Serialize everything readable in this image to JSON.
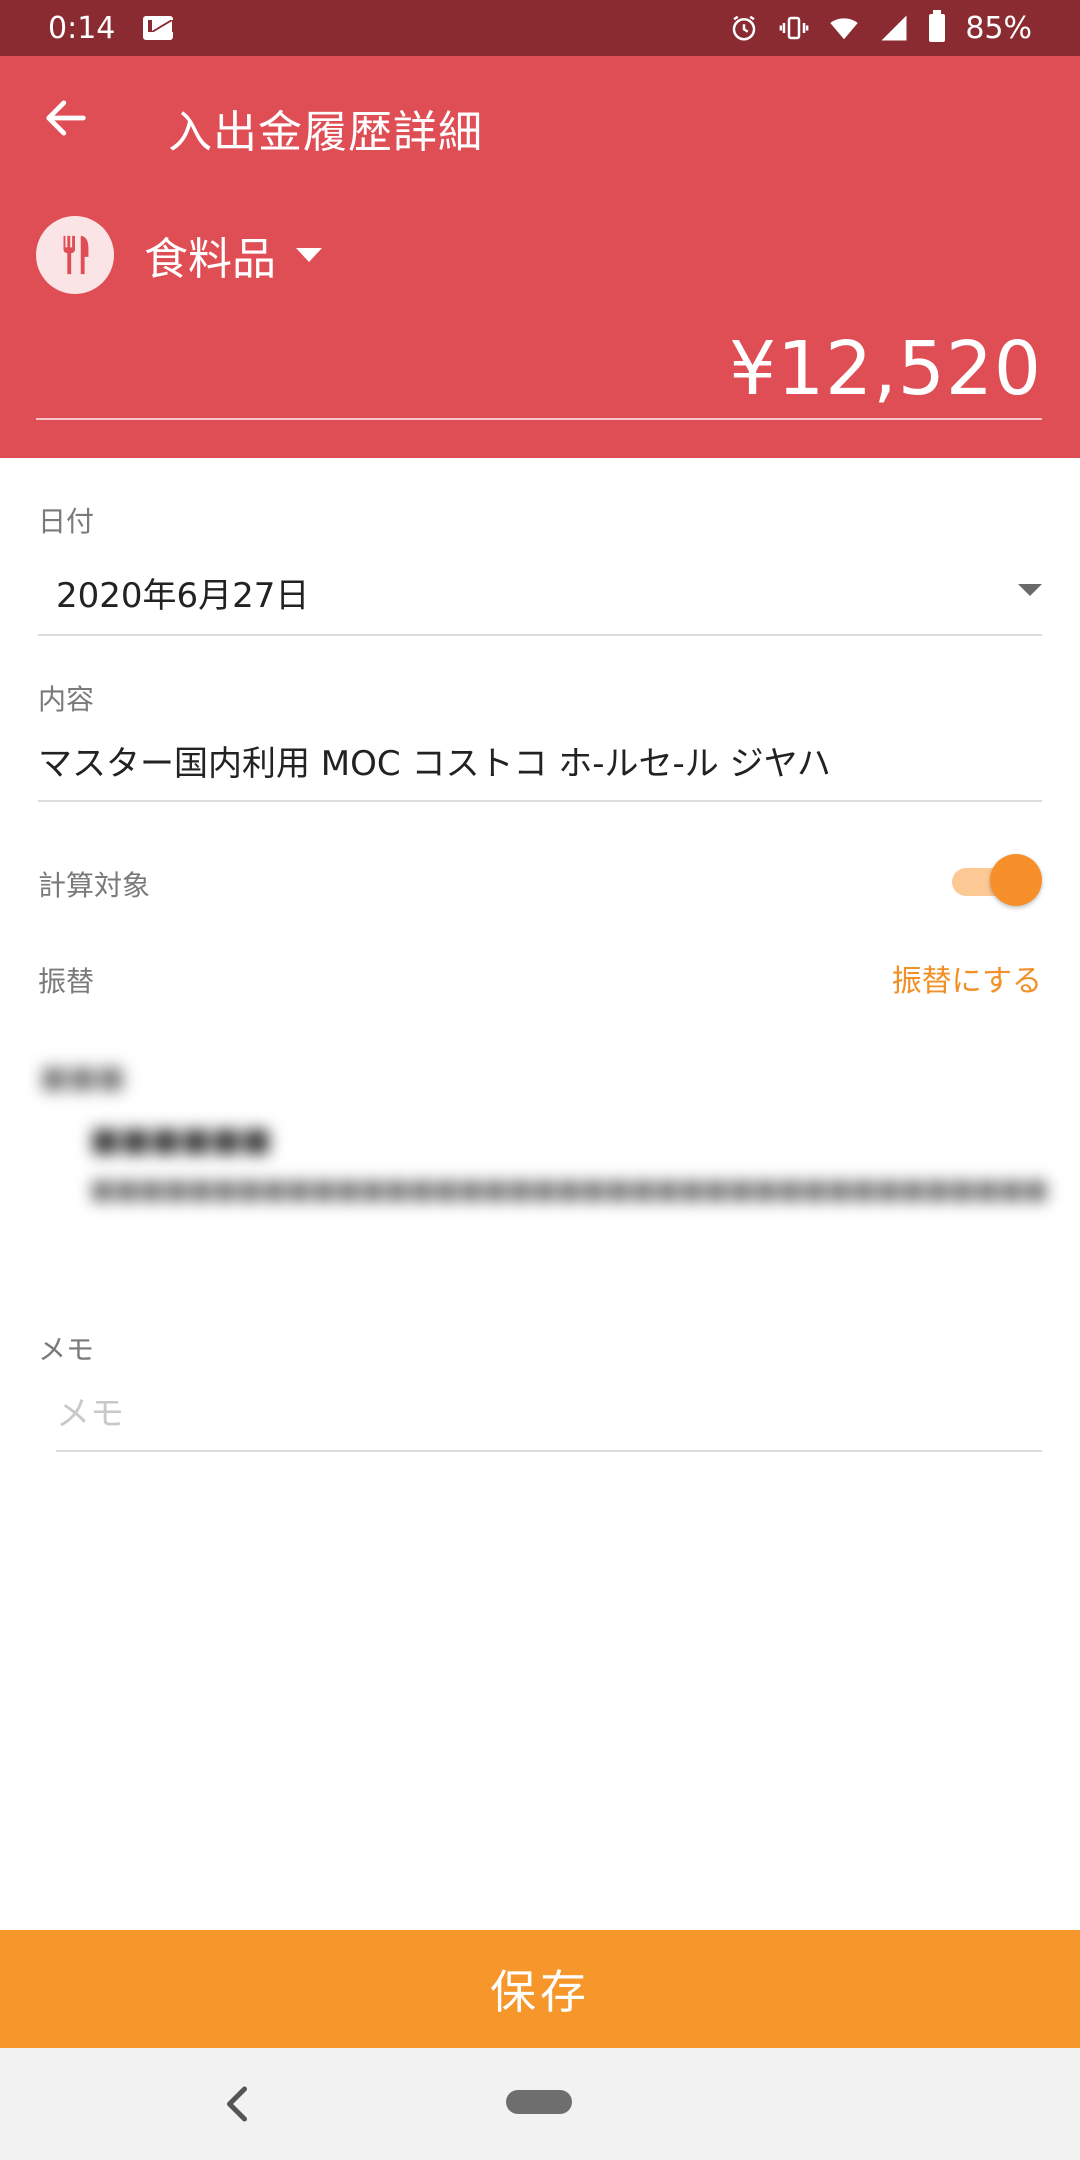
{
  "status_bar": {
    "time": "0:14",
    "battery": "85%",
    "icons": [
      "mail-icon",
      "alarm-icon",
      "vibrate-icon",
      "wifi-icon",
      "signal-icon",
      "battery-icon"
    ]
  },
  "header": {
    "title": "入出金履歴詳細",
    "category": {
      "label": "食料品",
      "icon": "fork-knife-icon"
    },
    "amount": "¥12,520",
    "color": "#e04e55"
  },
  "form": {
    "date": {
      "label": "日付",
      "value": "2020年6月27日"
    },
    "content": {
      "label": "内容",
      "value": "マスター国内利用 MOC コストコ ホ-ルセ-ル ジヤハ"
    },
    "calc_target": {
      "label": "計算対象",
      "enabled": true
    },
    "transfer": {
      "label": "振替",
      "action": "振替にする"
    },
    "memo": {
      "label": "メモ",
      "placeholder": "メモ",
      "value": ""
    }
  },
  "footer": {
    "save_label": "保存",
    "color": "#f7962a"
  },
  "accent": "#f28f26"
}
